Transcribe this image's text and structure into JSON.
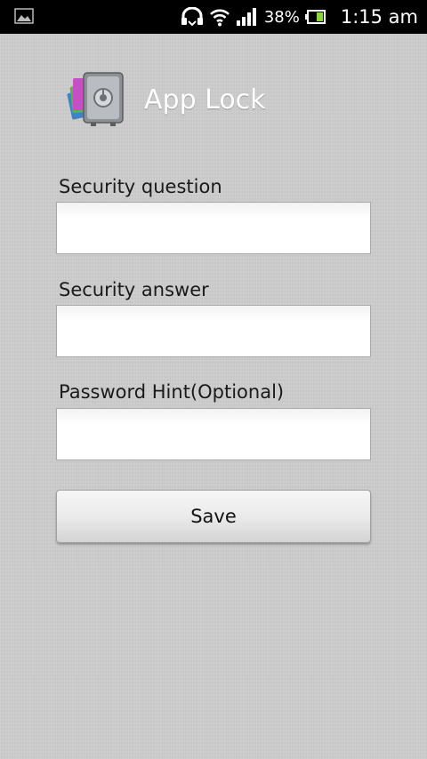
{
  "status_bar": {
    "battery_percent": "38%",
    "time": "1:15 am",
    "icons": [
      "image-notification-icon",
      "headset-icon",
      "wifi-icon",
      "signal-icon",
      "battery-icon"
    ],
    "battery_level": 0.38
  },
  "app": {
    "title": "App Lock",
    "logo_icon": "vault-lock-icon"
  },
  "form": {
    "security_question": {
      "label": "Security question",
      "value": ""
    },
    "security_answer": {
      "label": "Security answer",
      "value": ""
    },
    "password_hint": {
      "label": "Password Hint(Optional)",
      "value": ""
    },
    "save_label": "Save"
  },
  "colors": {
    "status_bar_bg": "#000000",
    "background": "#cdcdcd",
    "title_text": "#ffffff",
    "label_text": "#1a1a1a"
  }
}
